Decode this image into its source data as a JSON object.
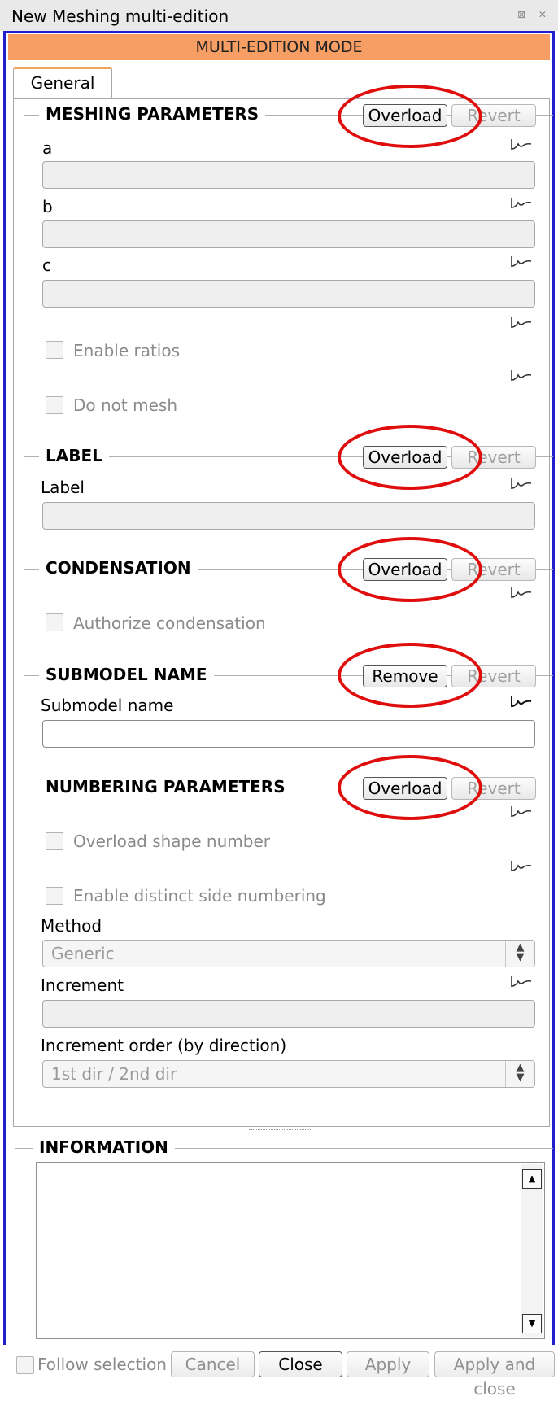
{
  "window": {
    "title": "New Meshing multi-edition",
    "title_icons": "⊠ ✕"
  },
  "banner": "MULTI-EDITION MODE",
  "tabs": [
    {
      "label": "General"
    }
  ],
  "sections": {
    "meshing": {
      "title": "MESHING PARAMETERS",
      "overload": "Overload",
      "revert": "Revert",
      "fields": {
        "a": "a",
        "b": "b",
        "c": "c"
      },
      "enable_ratios": "Enable ratios",
      "do_not_mesh": "Do not mesh"
    },
    "label": {
      "title": "LABEL",
      "overload": "Overload",
      "revert": "Revert",
      "field_label": "Label"
    },
    "condensation": {
      "title": "CONDENSATION",
      "overload": "Overload",
      "revert": "Revert",
      "authorize": "Authorize condensation"
    },
    "submodel": {
      "title": "SUBMODEL NAME",
      "remove": "Remove",
      "revert": "Revert",
      "field_label": "Submodel name"
    },
    "numbering": {
      "title": "NUMBERING PARAMETERS",
      "overload": "Overload",
      "revert": "Revert",
      "overload_shape": "Overload shape number",
      "distinct_side": "Enable distinct side numbering",
      "method_label": "Method",
      "method_value": "Generic",
      "increment_label": "Increment",
      "increment_order_label": "Increment order (by direction)",
      "increment_order_value": "1st dir / 2nd dir"
    }
  },
  "information": {
    "title": "INFORMATION"
  },
  "footer": {
    "follow_selection": "Follow selection",
    "cancel": "Cancel",
    "close": "Close",
    "apply": "Apply",
    "apply_close": "Apply and close"
  },
  "colors": {
    "banner": "#f79e64",
    "frame": "#1f1fd0",
    "highlight_ring": "#e00d0d",
    "tab_accent": "#f0a35a"
  }
}
